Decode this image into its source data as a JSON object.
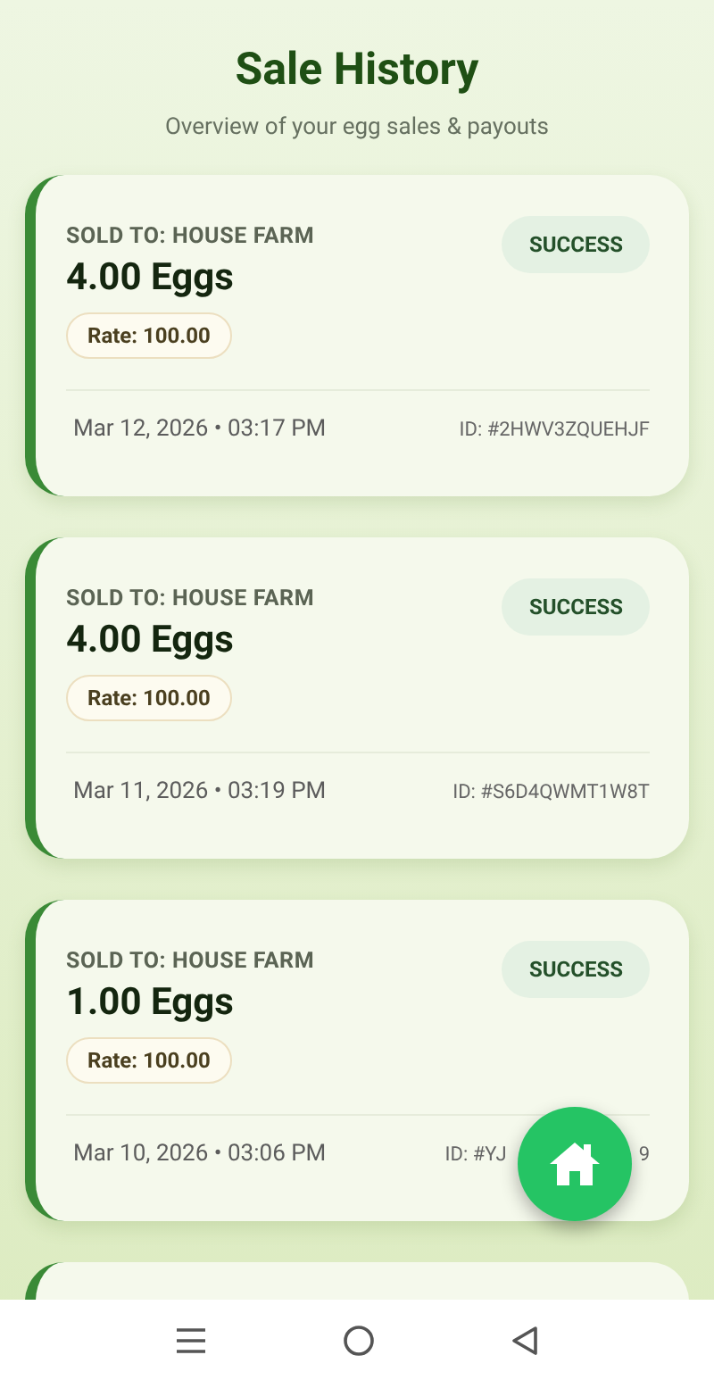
{
  "header": {
    "title": "Sale History",
    "subtitle": "Overview of your egg sales & payouts"
  },
  "sales": [
    {
      "buyer": "SOLD TO: HOUSE FARM",
      "amount": "4.00 Eggs",
      "rate": "Rate: 100.00",
      "status": "SUCCESS",
      "date": "Mar 12, 2026 • 03:17 PM",
      "id_parts": [
        "ID: #2HWV3ZQUEHJF"
      ]
    },
    {
      "buyer": "SOLD TO: HOUSE FARM",
      "amount": "4.00 Eggs",
      "rate": "Rate: 100.00",
      "status": "SUCCESS",
      "date": "Mar 11, 2026 • 03:19 PM",
      "id_parts": [
        "ID: #S6D4QWMT1W8T"
      ]
    },
    {
      "buyer": "SOLD TO: HOUSE FARM",
      "amount": "1.00 Eggs",
      "rate": "Rate: 100.00",
      "status": "SUCCESS",
      "date": "Mar 10, 2026 • 03:06 PM",
      "id_parts": [
        "ID: #YJ",
        "9"
      ]
    }
  ],
  "nav_bar": [
    {
      "kind": "menu"
    },
    {
      "kind": "home"
    },
    {
      "kind": "back"
    }
  ]
}
